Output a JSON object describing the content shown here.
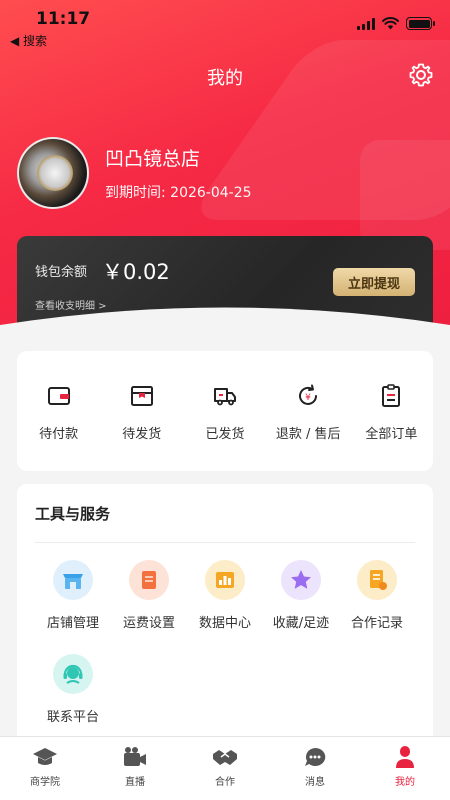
{
  "status": {
    "time": "11:17",
    "back_label": "◀ 搜索"
  },
  "header": {
    "title": "我的"
  },
  "profile": {
    "store_name": "凹凸镜总店",
    "expiry": "到期时间: 2026-04-25"
  },
  "wallet": {
    "label": "钱包余额",
    "amount": "￥0.02",
    "detail_link": "查看收支明细 >",
    "withdraw_label": "立即提现"
  },
  "orders": [
    {
      "label": "待付款",
      "icon": "wallet-icon"
    },
    {
      "label": "待发货",
      "icon": "box-icon"
    },
    {
      "label": "已发货",
      "icon": "truck-icon"
    },
    {
      "label": "退款 / 售后",
      "icon": "refund-icon"
    },
    {
      "label": "全部订单",
      "icon": "order-list-icon"
    }
  ],
  "tools": {
    "title": "工具与服务",
    "items": [
      {
        "label": "店铺管理",
        "icon": "store-icon",
        "color": "#3aa0e8"
      },
      {
        "label": "运费设置",
        "icon": "shipping-fee-icon",
        "color": "#f2713e"
      },
      {
        "label": "数据中心",
        "icon": "data-chart-icon",
        "color": "#f5a623"
      },
      {
        "label": "收藏/足迹",
        "icon": "star-icon",
        "color": "#9a6cf0"
      },
      {
        "label": "合作记录",
        "icon": "document-icon",
        "color": "#f5a623"
      },
      {
        "label": "联系平台",
        "icon": "customer-service-icon",
        "color": "#2fc7b3"
      }
    ]
  },
  "tabbar": [
    {
      "label": "商学院",
      "icon": "graduation-cap-icon",
      "active": false
    },
    {
      "label": "直播",
      "icon": "video-camera-icon",
      "active": false
    },
    {
      "label": "合作",
      "icon": "handshake-icon",
      "active": false
    },
    {
      "label": "消息",
      "icon": "chat-bubble-icon",
      "active": false
    },
    {
      "label": "我的",
      "icon": "person-icon",
      "active": true
    }
  ],
  "colors": {
    "brand_red": "#f62a45",
    "active_tab": "#e8233f",
    "gold": "#d4b273"
  }
}
